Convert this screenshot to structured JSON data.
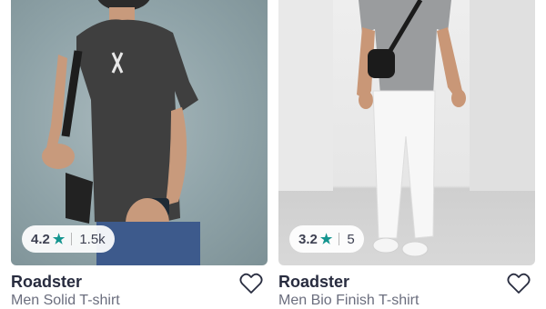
{
  "products": [
    {
      "brand": "Roadster",
      "name": "Men Solid T-shirt",
      "rating": "4.2",
      "rating_count": "1.5k",
      "star_color": "#14958f",
      "icons": [
        "star-icon",
        "heart-outline-icon"
      ]
    },
    {
      "brand": "Roadster",
      "name": "Men Bio Finish T-shirt",
      "rating": "3.2",
      "rating_count": "5",
      "star_color": "#14958f",
      "icons": [
        "star-icon",
        "heart-outline-icon"
      ]
    }
  ]
}
